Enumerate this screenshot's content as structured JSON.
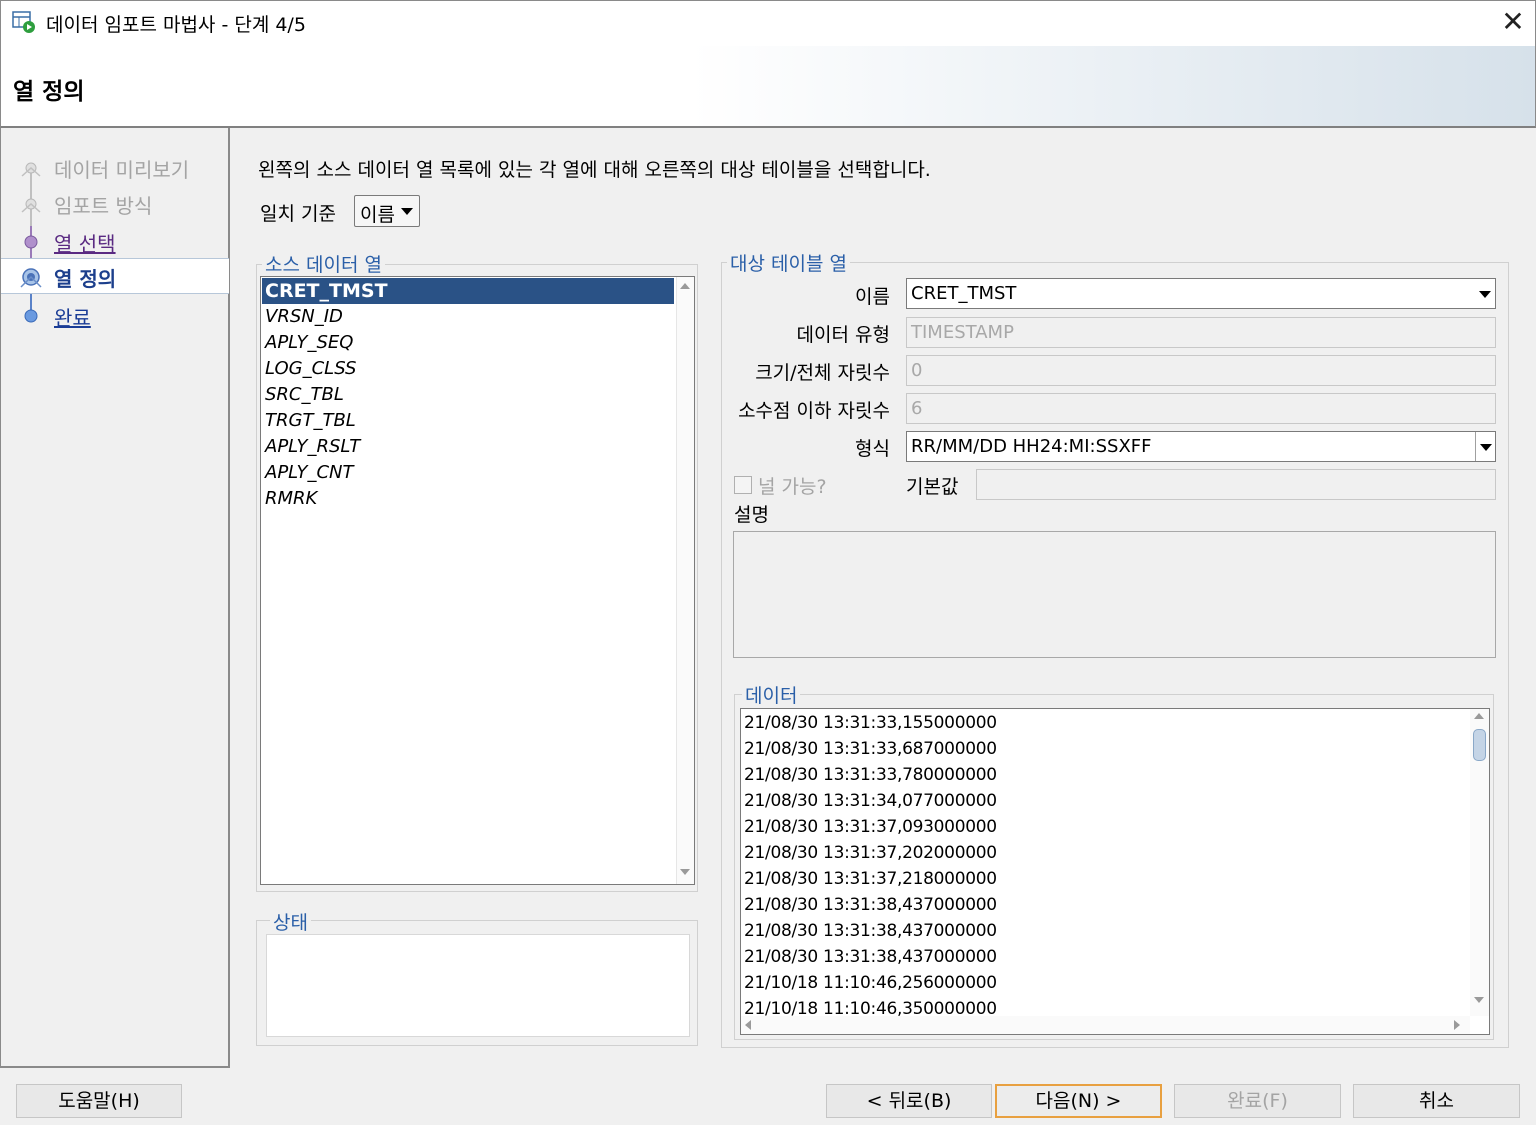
{
  "window": {
    "title": "데이터 임포트 마법사 - 단계 4/5",
    "close_glyph": "✕"
  },
  "header": {
    "title": "열 정의"
  },
  "nav": {
    "items": [
      {
        "label": "데이터 미리보기"
      },
      {
        "label": "임포트 방식"
      },
      {
        "label": "열 선택"
      },
      {
        "label": "열 정의"
      },
      {
        "label": "완료"
      }
    ]
  },
  "main": {
    "instruction": "왼쪽의 소스 데이터 열 목록에 있는 각 열에 대해 오른쪽의 대상 테이블을 선택합니다.",
    "match_label": "일치 기준",
    "match_value": "이름"
  },
  "source": {
    "legend": "소스 데이터 열",
    "columns": [
      "CRET_TMST",
      "VRSN_ID",
      "APLY_SEQ",
      "LOG_CLSS",
      "SRC_TBL",
      "TRGT_TBL",
      "APLY_RSLT",
      "APLY_CNT",
      "RMRK"
    ],
    "selected": "CRET_TMST"
  },
  "status": {
    "legend": "상태"
  },
  "target": {
    "legend": "대상 테이블 열",
    "name_label": "이름",
    "name_value": "CRET_TMST",
    "type_label": "데이터 유형",
    "type_value": "TIMESTAMP",
    "size_label": "크기/전체 자릿수",
    "size_value": "0",
    "scale_label": "소수점 이하 자릿수",
    "scale_value": "6",
    "format_label": "형식",
    "format_value": "RR/MM/DD HH24:MI:SSXFF",
    "nullable_label": "널 가능?",
    "default_label": "기본값",
    "default_value": "",
    "description_label": "설명",
    "description_value": ""
  },
  "data": {
    "legend": "데이터",
    "rows": [
      "21/08/30 13:31:33,155000000",
      "21/08/30 13:31:33,687000000",
      "21/08/30 13:31:33,780000000",
      "21/08/30 13:31:34,077000000",
      "21/08/30 13:31:37,093000000",
      "21/08/30 13:31:37,202000000",
      "21/08/30 13:31:37,218000000",
      "21/08/30 13:31:38,437000000",
      "21/08/30 13:31:38,437000000",
      "21/08/30 13:31:38,437000000",
      "21/10/18 11:10:46,256000000",
      "21/10/18 11:10:46,350000000"
    ]
  },
  "buttons": {
    "help": "도움말(H)",
    "back": "< 뒤로(B)",
    "next": "다음(N) >",
    "finish": "완료(F)",
    "cancel": "취소"
  }
}
